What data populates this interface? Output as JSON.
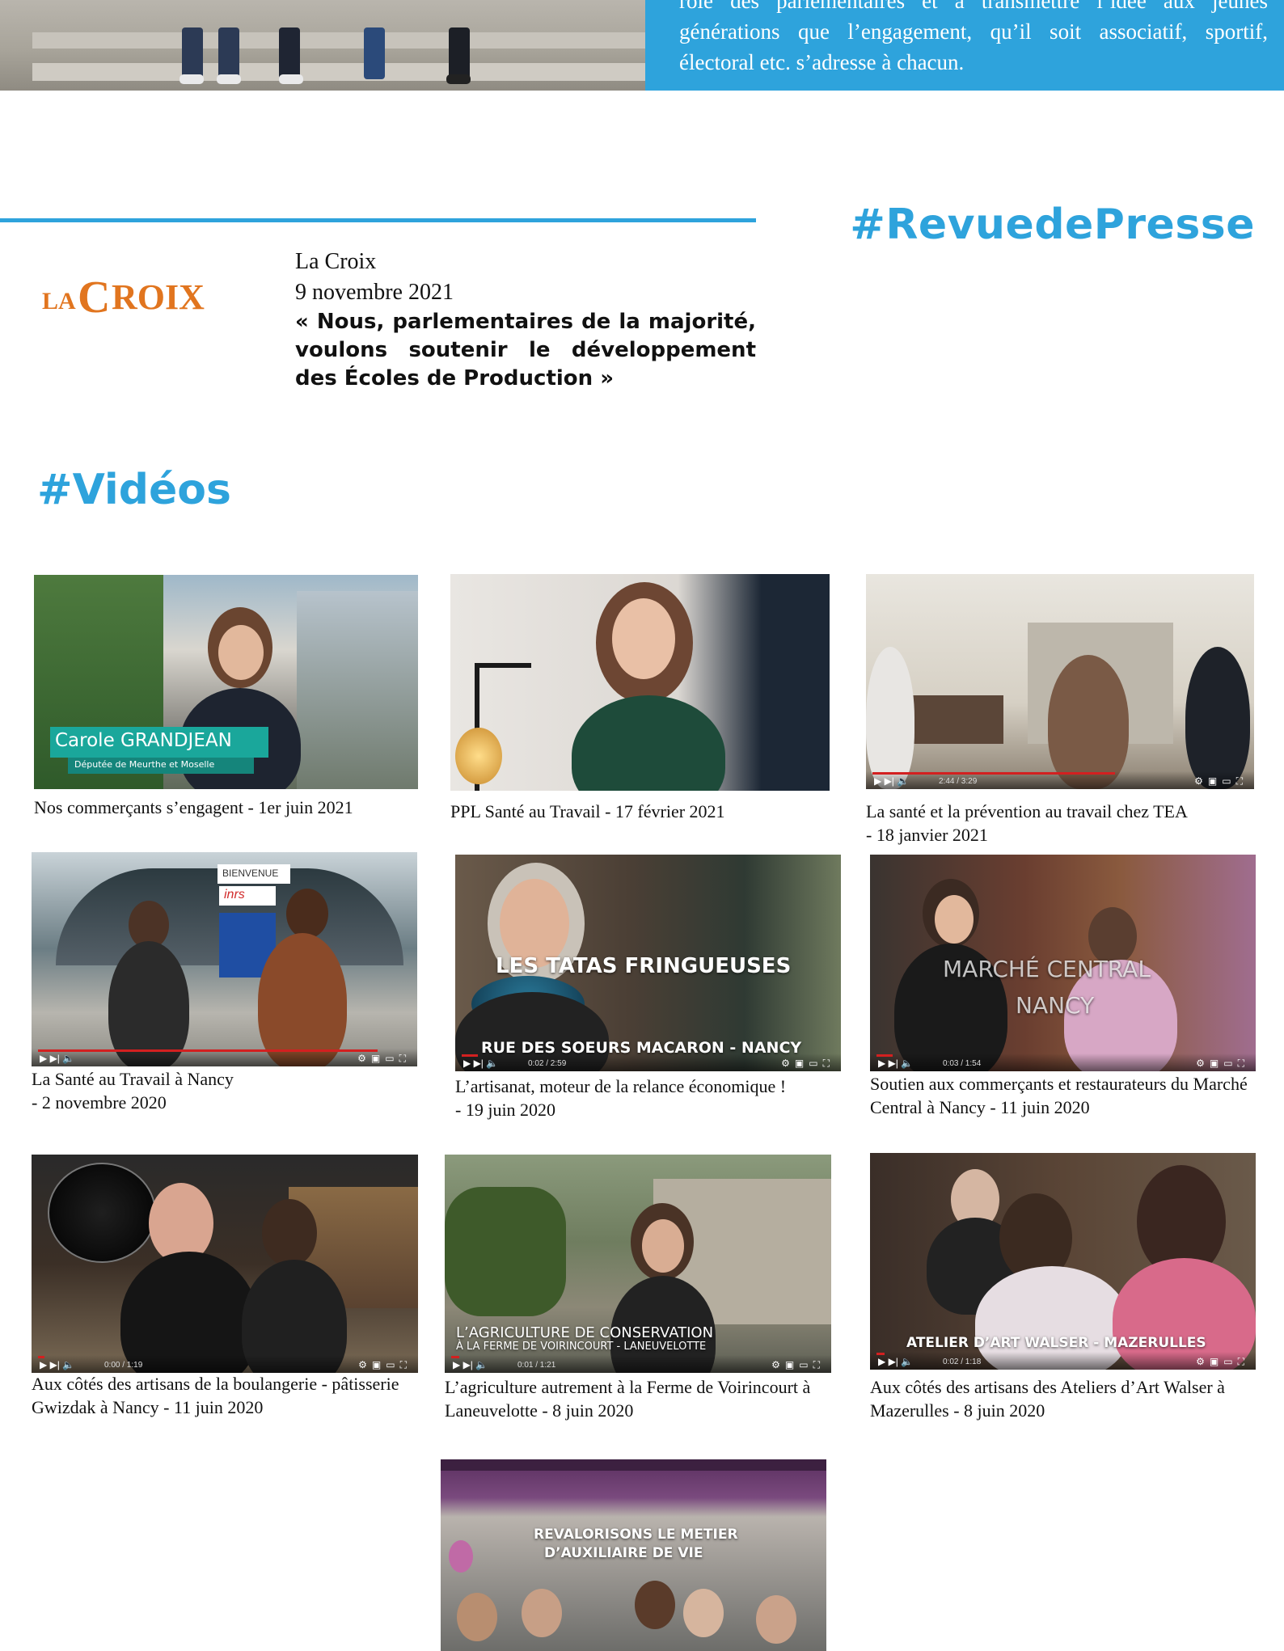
{
  "top_band": {
    "text": "rôle des parlementaires et à transmettre l’idée aux jeunes générations que l’engagement, qu’il soit associatif, sportif, électoral etc. s’adresse à chacun.",
    "accent_color": "#2ea3dc"
  },
  "press": {
    "heading": "#RevuedePresse",
    "logo_text": "LA CROIX",
    "source": "La Croix",
    "date": "9 novembre 2021",
    "title": "« Nous, parlementaires de la majorité, voulons soutenir le développement des Écoles de Production »"
  },
  "videos": {
    "heading": "#Vidéos",
    "items": [
      {
        "caption": "Nos commerçants s’engagent - 1er juin 2021",
        "overlay_name": "Carole GRANDJEAN",
        "overlay_role": "Députée de Meurthe et Moselle"
      },
      {
        "caption": "PPL Santé au Travail - 17 février 2021"
      },
      {
        "caption": "La santé et la prévention au travail chez TEA\n- 18 janvier 2021",
        "time": "2:44 / 3:29"
      },
      {
        "caption": "La Santé au Travail à Nancy\n- 2 novembre 2020",
        "sign1": "BIENVENUE",
        "sign2": "inrs"
      },
      {
        "caption": "L’artisanat, moteur de la relance économique !\n - 19 juin 2020",
        "overlay1": "LES TATAS FRINGUEUSES",
        "overlay2": "RUE DES SOEURS MACARON - NANCY",
        "time": "0:02 / 2:59"
      },
      {
        "caption": "Soutien aux commerçants et restaurateurs du Marché Central à Nancy - 11 juin 2020",
        "overlay1": "MARCHÉ CENTRAL",
        "overlay2": "NANCY",
        "time": "0:03 / 1:54"
      },
      {
        "caption": "Aux côtés des artisans de la boulangerie - pâtisserie Gwizdak à Nancy - 11 juin 2020",
        "time": "0:00 / 1:19"
      },
      {
        "caption": "L’agriculture autrement à la Ferme de Voirincourt à Laneuvelotte -  8 juin 2020",
        "overlay1": "L’AGRICULTURE DE CONSERVATION",
        "overlay2": "À LA FERME DE VOIRINCOURT - LANEUVELOTTE",
        "time": "0:01 / 1:21"
      },
      {
        "caption": "Aux côtés des artisans des Ateliers d’Art Walser à Mazerulles -  8 juin 2020",
        "overlay1": "ATELIER D’ART WALSER - MAZERULLES",
        "time": "0:02 / 1:18"
      },
      {
        "overlay1": "REVALORISONS LE METIER",
        "overlay2": "D’AUXILIAIRE DE VIE"
      }
    ]
  }
}
